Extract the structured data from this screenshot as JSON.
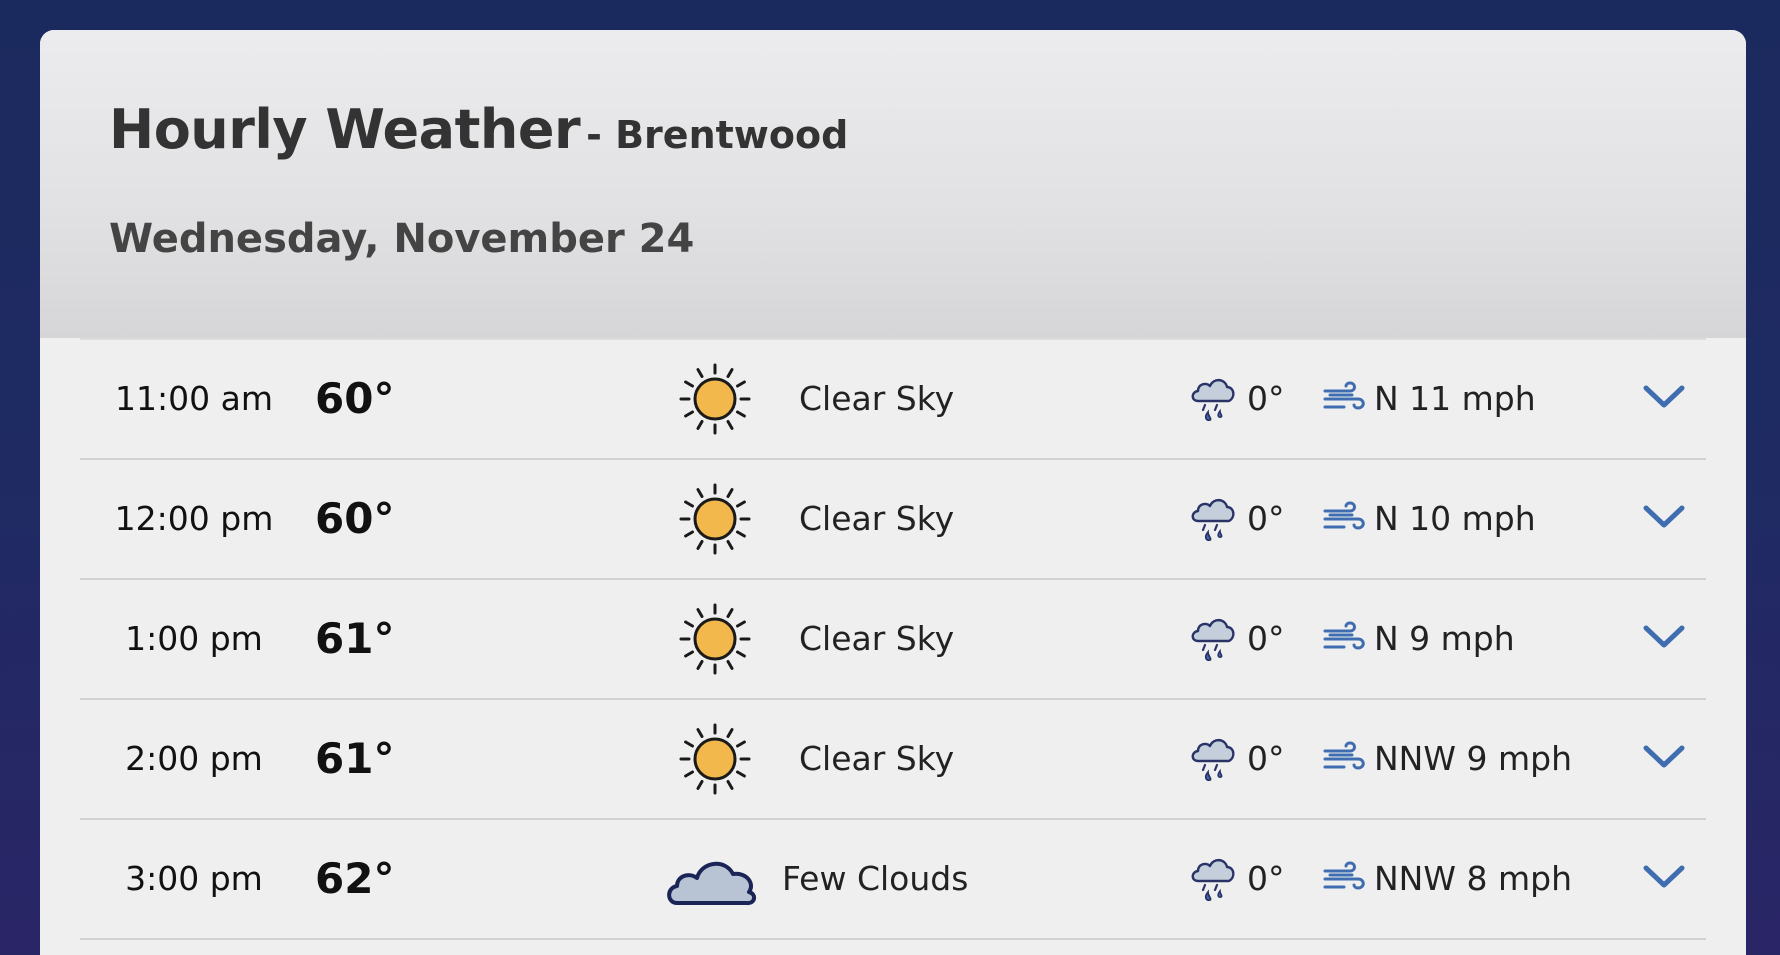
{
  "header": {
    "title": "Hourly Weather",
    "location": "- Brentwood",
    "date": "Wednesday, November 24"
  },
  "colors": {
    "accent": "#3f6db0",
    "sun": "#f2b84b",
    "cloud_fill": "#b8c4d4",
    "cloud_stroke": "#1b2456"
  },
  "rows": [
    {
      "time": "11:00 am",
      "temp": "60°",
      "icon": "sun-icon",
      "condition": "Clear Sky",
      "precip": "0°",
      "wind": "N 11 mph"
    },
    {
      "time": "12:00 pm",
      "temp": "60°",
      "icon": "sun-icon",
      "condition": "Clear Sky",
      "precip": "0°",
      "wind": "N 10 mph"
    },
    {
      "time": "1:00 pm",
      "temp": "61°",
      "icon": "sun-icon",
      "condition": "Clear Sky",
      "precip": "0°",
      "wind": "N 9 mph"
    },
    {
      "time": "2:00 pm",
      "temp": "61°",
      "icon": "sun-icon",
      "condition": "Clear Sky",
      "precip": "0°",
      "wind": "NNW 9 mph"
    },
    {
      "time": "3:00 pm",
      "temp": "62°",
      "icon": "cloud-icon",
      "condition": "Few Clouds",
      "precip": "0°",
      "wind": "NNW 8 mph"
    }
  ]
}
